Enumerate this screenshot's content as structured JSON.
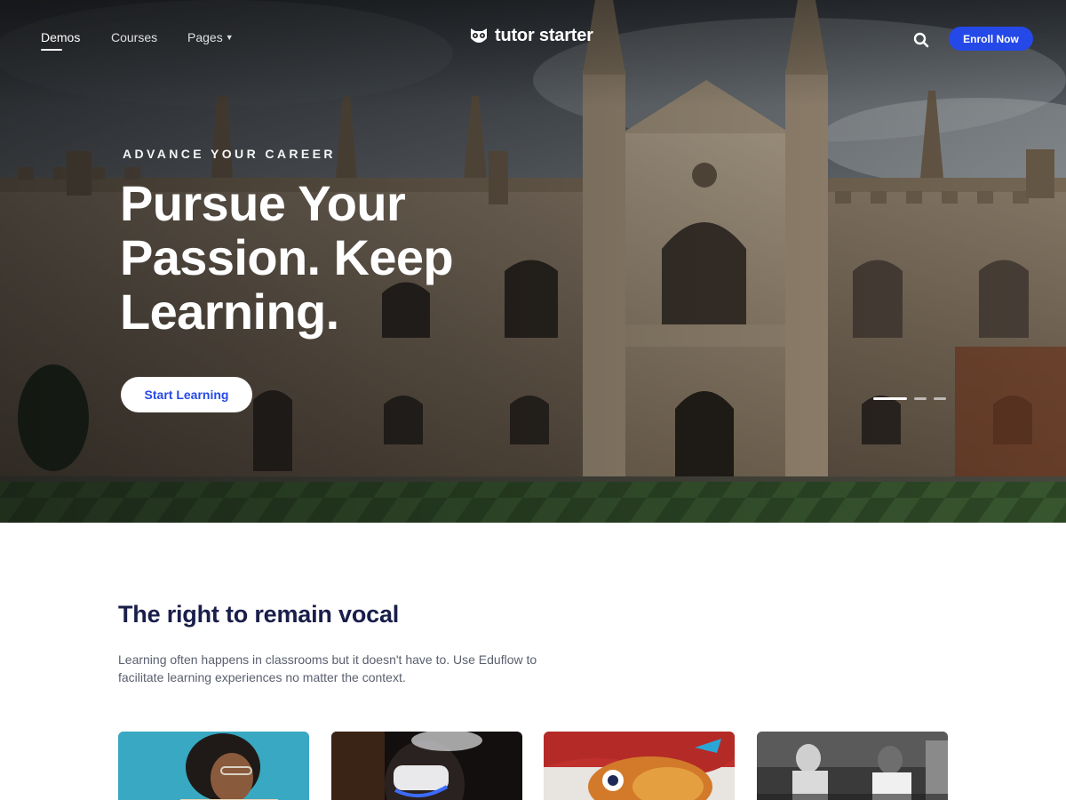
{
  "nav": {
    "links": [
      {
        "label": "Demos"
      },
      {
        "label": "Courses"
      },
      {
        "label": "Pages"
      }
    ],
    "logo_text": "tutor starter",
    "enroll_label": "Enroll Now"
  },
  "hero": {
    "eyebrow": "ADVANCE YOUR CAREER",
    "headline_lines": [
      "Pursue Your",
      "Passion. Keep",
      "Learning."
    ],
    "cta_label": "Start Learning",
    "slides": {
      "count": 3,
      "active": 1
    }
  },
  "section": {
    "title": "The right to remain vocal",
    "description_lines": [
      "Learning often happens in classrooms but it doesn't have to. Use Eduflow to",
      "facilitate learning experiences no matter the context."
    ]
  },
  "cards": [
    {
      "subject": "woman-with-book"
    },
    {
      "subject": "person-vr-headset"
    },
    {
      "subject": "fish-mural"
    },
    {
      "subject": "people-at-table"
    }
  ],
  "colors": {
    "accent": "#2549e8",
    "heading": "#1a1e4a",
    "body_text": "#5a5f6e"
  }
}
